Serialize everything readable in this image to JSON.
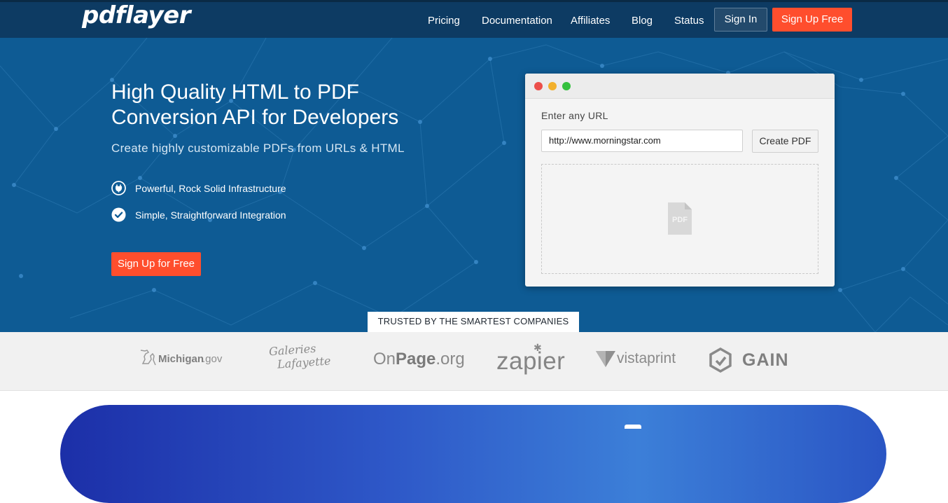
{
  "navbar": {
    "logo": "pdflayer",
    "links": [
      "Pricing",
      "Documentation",
      "Affiliates",
      "Blog",
      "Status"
    ],
    "signin_label": "Sign In",
    "signup_label": "Sign Up Free",
    "colors": {
      "background": "#0d3b63",
      "cta": "#ff4e2d"
    }
  },
  "hero": {
    "title_line1": "High Quality HTML to PDF",
    "title_line2": "Conversion API for Developers",
    "subtitle": "Create highly customizable PDFs from URLs & HTML",
    "features": [
      {
        "icon": "plug-icon",
        "text": "Powerful, Rock Solid Infrastructure"
      },
      {
        "icon": "checkmark-icon",
        "text": "Simple, Straightforward Integration"
      }
    ],
    "cta_label": "Sign Up for Free",
    "background_color": "#0e5b94"
  },
  "demo": {
    "label": "Enter any URL",
    "url_value": "http://www.morningstar.com",
    "button_label": "Create PDF",
    "preview_icon_text": "PDF",
    "window_dots": [
      "#ec4f4a",
      "#f2b02c",
      "#35c13f"
    ]
  },
  "trusted": {
    "heading": "TRUSTED BY THE SMARTEST COMPANIES",
    "logos": {
      "michigan_main": "Michigan",
      "michigan_suffix": ".gov",
      "galeries_line1": "Galeries",
      "galeries_line2": "Lafayette",
      "onpage_a": "On",
      "onpage_b": "Page",
      "onpage_c": ".org",
      "zapier": "zapier",
      "vistaprint": "vistaprint",
      "gain": "GAIN"
    }
  }
}
